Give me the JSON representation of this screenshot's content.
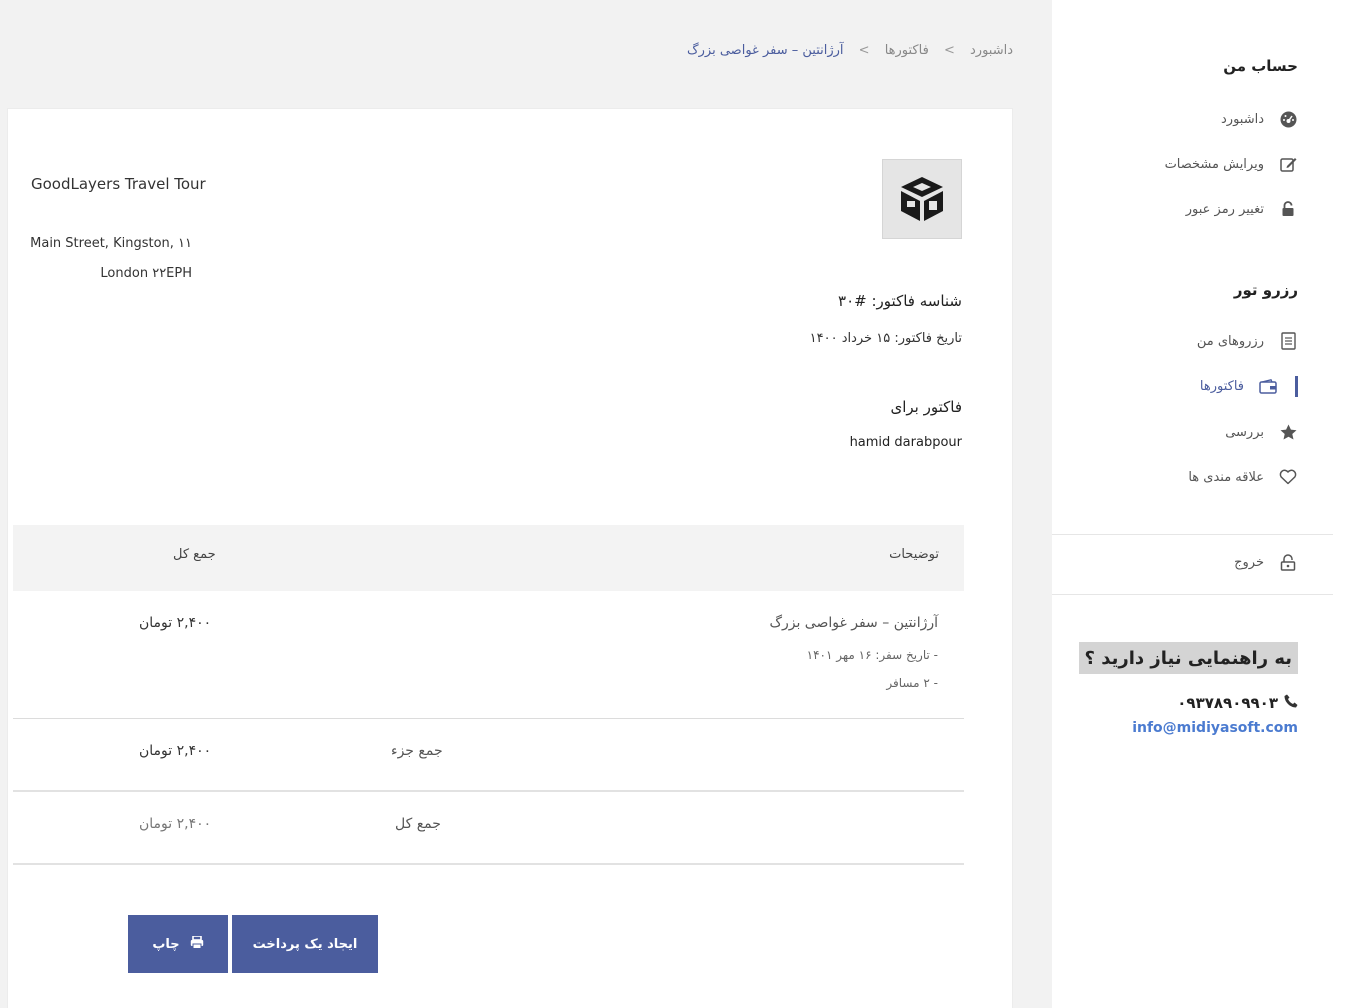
{
  "breadcrumb": {
    "items": [
      "داشبورد",
      "فاکتورها",
      "آرژانتین – سفر غواصی بزرگ"
    ],
    "separator": ">"
  },
  "company": {
    "name": "GoodLayers Travel Tour",
    "address_line1": "Main Street, Kingston, ۱۱",
    "address_line2": "London ۲۲EPH"
  },
  "invoice": {
    "id_label": "شناسه فاکتور: #۳۰",
    "date_label": "تاریخ فاکتور: ۱۵ خرداد ۱۴۰۰",
    "bill_to_title": "فاکتور برای",
    "bill_to_name": "hamid darabpour"
  },
  "table": {
    "col_description": "توضیحات",
    "col_total": "جمع کل",
    "item": {
      "title": "آرژانتین – سفر غواصی بزرگ",
      "travel_date": "- تاریخ سفر: ۱۶ مهر ۱۴۰۱",
      "travelers": "- ۲ مسافر",
      "price": "۲,۴۰۰ تومان"
    },
    "subtotal_label": "جمع جزء",
    "subtotal_value": "۲,۴۰۰ تومان",
    "total_label": "جمع کل",
    "total_value": "۲,۴۰۰ تومان"
  },
  "buttons": {
    "pay": "ایجاد یک پرداخت",
    "print": "چاپ"
  },
  "sidebar": {
    "account_heading": "حساب من",
    "account_items": [
      {
        "label": "داشبورد",
        "icon": "dashboard-icon"
      },
      {
        "label": "ویرایش مشخصات",
        "icon": "edit-icon"
      },
      {
        "label": "تغییر رمز عبور",
        "icon": "lock-icon"
      }
    ],
    "booking_heading": "رزرو تور",
    "booking_items": [
      {
        "label": "رزروهای من",
        "icon": "document-icon"
      },
      {
        "label": "فاکتورها",
        "icon": "wallet-icon"
      },
      {
        "label": "بررسی",
        "icon": "star-icon"
      },
      {
        "label": "علاقه مندی ها",
        "icon": "heart-icon"
      }
    ],
    "logout": {
      "label": "خروج",
      "icon": "unlock-icon"
    },
    "help_title": "به راهنمایی نیاز دارید ؟",
    "help_phone": "۰۹۳۷۸۹۰۹۹۰۳",
    "help_email": "info@midiyasoft.com"
  },
  "colors": {
    "accent": "#4b5d9e",
    "link": "#4b7bd0",
    "main_bg": "#f2f2f2"
  }
}
